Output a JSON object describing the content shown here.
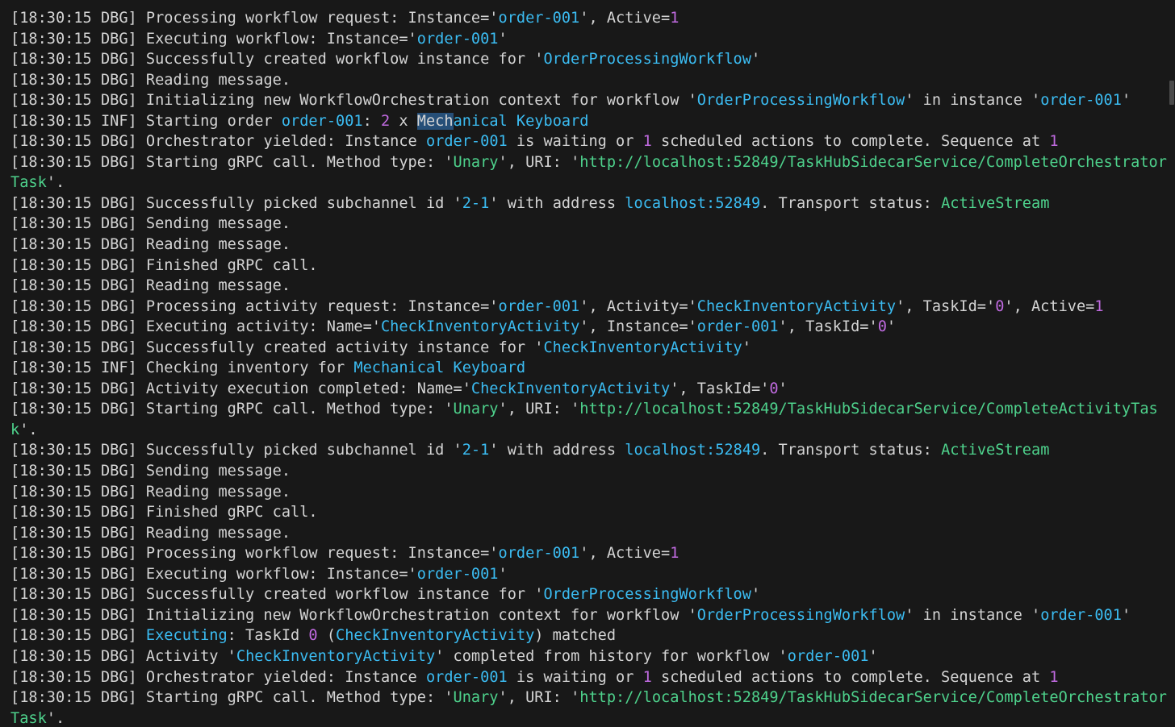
{
  "colors": {
    "background": "#181818",
    "text": "#d4d4d4",
    "identifier": "#3bbcf2",
    "string_value": "#4ed28c",
    "number": "#c06ae0",
    "selection": "#264f78"
  },
  "log_lines": [
    [
      [
        "t",
        "[18:30:15 DBG] Processing workflow request: Instance='"
      ],
      [
        "c",
        "order-001"
      ],
      [
        "t",
        "', Active="
      ],
      [
        "n",
        "1"
      ]
    ],
    [
      [
        "t",
        "[18:30:15 DBG] Executing workflow: Instance='"
      ],
      [
        "c",
        "order-001"
      ],
      [
        "t",
        "'"
      ]
    ],
    [
      [
        "t",
        "[18:30:15 DBG] Successfully created workflow instance for '"
      ],
      [
        "c",
        "OrderProcessingWorkflow"
      ],
      [
        "t",
        "'"
      ]
    ],
    [
      [
        "t",
        "[18:30:15 DBG] Reading message."
      ]
    ],
    [
      [
        "t",
        "[18:30:15 DBG] Initializing new WorkflowOrchestration context for workflow '"
      ],
      [
        "c",
        "OrderProcessingWorkflow"
      ],
      [
        "t",
        "' in instance '"
      ],
      [
        "c",
        "order-001"
      ],
      [
        "t",
        "'"
      ]
    ],
    [
      [
        "t",
        "[18:30:15 INF] Starting order "
      ],
      [
        "c",
        "order-001"
      ],
      [
        "t",
        ": "
      ],
      [
        "n",
        "2"
      ],
      [
        "t",
        " x "
      ],
      [
        "hl",
        "Mech"
      ],
      [
        "c",
        "anical Keyboard"
      ]
    ],
    [
      [
        "t",
        "[18:30:15 DBG] Orchestrator yielded: Instance "
      ],
      [
        "c",
        "order-001"
      ],
      [
        "t",
        " is waiting or "
      ],
      [
        "n",
        "1"
      ],
      [
        "t",
        " scheduled actions to complete. Sequence at "
      ],
      [
        "n",
        "1"
      ]
    ],
    [
      [
        "t",
        "[18:30:15 DBG] Starting gRPC call. Method type: '"
      ],
      [
        "s",
        "Unary"
      ],
      [
        "t",
        "', URI: '"
      ],
      [
        "s",
        "http://localhost:52849/TaskHubSidecarService/CompleteOrchestratorTask"
      ],
      [
        "t",
        "'."
      ]
    ],
    [
      [
        "t",
        "[18:30:15 DBG] Successfully picked subchannel id '"
      ],
      [
        "c",
        "2-1"
      ],
      [
        "t",
        "' with address "
      ],
      [
        "c",
        "localhost:52849"
      ],
      [
        "t",
        ". Transport status: "
      ],
      [
        "s",
        "ActiveStream"
      ]
    ],
    [
      [
        "t",
        "[18:30:15 DBG] Sending message."
      ]
    ],
    [
      [
        "t",
        "[18:30:15 DBG] Reading message."
      ]
    ],
    [
      [
        "t",
        "[18:30:15 DBG] Finished gRPC call."
      ]
    ],
    [
      [
        "t",
        "[18:30:15 DBG] Reading message."
      ]
    ],
    [
      [
        "t",
        "[18:30:15 DBG] Processing activity request: Instance='"
      ],
      [
        "c",
        "order-001"
      ],
      [
        "t",
        "', Activity='"
      ],
      [
        "c",
        "CheckInventoryActivity"
      ],
      [
        "t",
        "', TaskId='"
      ],
      [
        "n",
        "0"
      ],
      [
        "t",
        "', Active="
      ],
      [
        "n",
        "1"
      ]
    ],
    [
      [
        "t",
        "[18:30:15 DBG] Executing activity: Name='"
      ],
      [
        "c",
        "CheckInventoryActivity"
      ],
      [
        "t",
        "', Instance='"
      ],
      [
        "c",
        "order-001"
      ],
      [
        "t",
        "', TaskId='"
      ],
      [
        "n",
        "0"
      ],
      [
        "t",
        "'"
      ]
    ],
    [
      [
        "t",
        "[18:30:15 DBG] Successfully created activity instance for '"
      ],
      [
        "c",
        "CheckInventoryActivity"
      ],
      [
        "t",
        "'"
      ]
    ],
    [
      [
        "t",
        "[18:30:15 INF] Checking inventory for "
      ],
      [
        "c",
        "Mechanical Keyboard"
      ]
    ],
    [
      [
        "t",
        "[18:30:15 DBG] Activity execution completed: Name='"
      ],
      [
        "c",
        "CheckInventoryActivity"
      ],
      [
        "t",
        "', TaskId='"
      ],
      [
        "n",
        "0"
      ],
      [
        "t",
        "'"
      ]
    ],
    [
      [
        "t",
        "[18:30:15 DBG] Starting gRPC call. Method type: '"
      ],
      [
        "s",
        "Unary"
      ],
      [
        "t",
        "', URI: '"
      ],
      [
        "s",
        "http://localhost:52849/TaskHubSidecarService/CompleteActivityTask"
      ],
      [
        "t",
        "'."
      ]
    ],
    [
      [
        "t",
        "[18:30:15 DBG] Successfully picked subchannel id '"
      ],
      [
        "c",
        "2-1"
      ],
      [
        "t",
        "' with address "
      ],
      [
        "c",
        "localhost:52849"
      ],
      [
        "t",
        ". Transport status: "
      ],
      [
        "s",
        "ActiveStream"
      ]
    ],
    [
      [
        "t",
        "[18:30:15 DBG] Sending message."
      ]
    ],
    [
      [
        "t",
        "[18:30:15 DBG] Reading message."
      ]
    ],
    [
      [
        "t",
        "[18:30:15 DBG] Finished gRPC call."
      ]
    ],
    [
      [
        "t",
        "[18:30:15 DBG] Reading message."
      ]
    ],
    [
      [
        "t",
        "[18:30:15 DBG] Processing workflow request: Instance='"
      ],
      [
        "c",
        "order-001"
      ],
      [
        "t",
        "', Active="
      ],
      [
        "n",
        "1"
      ]
    ],
    [
      [
        "t",
        "[18:30:15 DBG] Executing workflow: Instance='"
      ],
      [
        "c",
        "order-001"
      ],
      [
        "t",
        "'"
      ]
    ],
    [
      [
        "t",
        "[18:30:15 DBG] Successfully created workflow instance for '"
      ],
      [
        "c",
        "OrderProcessingWorkflow"
      ],
      [
        "t",
        "'"
      ]
    ],
    [
      [
        "t",
        "[18:30:15 DBG] Initializing new WorkflowOrchestration context for workflow '"
      ],
      [
        "c",
        "OrderProcessingWorkflow"
      ],
      [
        "t",
        "' in instance '"
      ],
      [
        "c",
        "order-001"
      ],
      [
        "t",
        "'"
      ]
    ],
    [
      [
        "t",
        "[18:30:15 DBG] "
      ],
      [
        "c",
        "Executing"
      ],
      [
        "t",
        ": TaskId "
      ],
      [
        "n",
        "0"
      ],
      [
        "t",
        " ("
      ],
      [
        "c",
        "CheckInventoryActivity"
      ],
      [
        "t",
        ") matched"
      ]
    ],
    [
      [
        "t",
        "[18:30:15 DBG] Activity '"
      ],
      [
        "c",
        "CheckInventoryActivity"
      ],
      [
        "t",
        "' completed from history for workflow '"
      ],
      [
        "c",
        "order-001"
      ],
      [
        "t",
        "'"
      ]
    ],
    [
      [
        "t",
        "[18:30:15 DBG] Orchestrator yielded: Instance "
      ],
      [
        "c",
        "order-001"
      ],
      [
        "t",
        " is waiting or "
      ],
      [
        "n",
        "1"
      ],
      [
        "t",
        " scheduled actions to complete. Sequence at "
      ],
      [
        "n",
        "1"
      ]
    ],
    [
      [
        "t",
        "[18:30:15 DBG] Starting gRPC call. Method type: '"
      ],
      [
        "s",
        "Unary"
      ],
      [
        "t",
        "', URI: '"
      ],
      [
        "s",
        "http://localhost:52849/TaskHubSidecarService/CompleteOrchestratorTask"
      ],
      [
        "t",
        "'."
      ]
    ]
  ]
}
